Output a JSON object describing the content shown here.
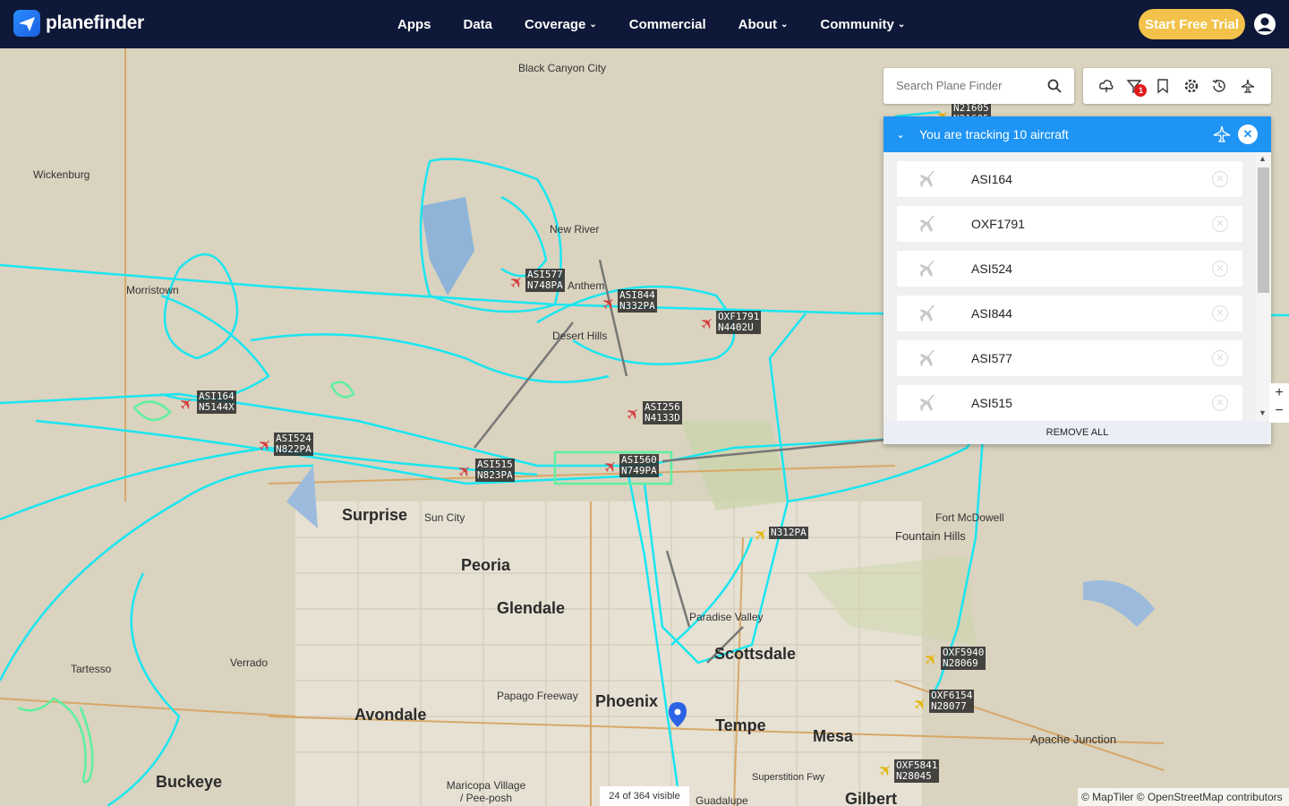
{
  "header": {
    "logo_text": "planefinder",
    "nav": [
      {
        "label": "Apps",
        "dropdown": false
      },
      {
        "label": "Data",
        "dropdown": false
      },
      {
        "label": "Coverage",
        "dropdown": true
      },
      {
        "label": "Commercial",
        "dropdown": false
      },
      {
        "label": "About",
        "dropdown": true
      },
      {
        "label": "Community",
        "dropdown": true
      }
    ],
    "trial_button": "Start Free Trial",
    "brand_color": "#0e1838",
    "accent_color": "#f3c24a"
  },
  "search": {
    "placeholder": "Search Plane Finder",
    "icon": "search-icon"
  },
  "toolbar": {
    "icons": [
      "weather-icon",
      "filter-icon",
      "bookmark-icon",
      "settings-icon",
      "history-icon",
      "aircraft-type-icon"
    ],
    "filter_badge": "1"
  },
  "tracking": {
    "title": "You are tracking 10 aircraft",
    "items": [
      "ASI164",
      "OXF1791",
      "ASI524",
      "ASI844",
      "ASI577",
      "ASI515"
    ],
    "remove_all": "REMOVE ALL",
    "panel_color": "#1e94f4"
  },
  "map": {
    "places": [
      {
        "name": "Black Canyon City",
        "big": false
      },
      {
        "name": "Wickenburg",
        "big": false
      },
      {
        "name": "New River",
        "big": false
      },
      {
        "name": "Anthem",
        "big": false
      },
      {
        "name": "Morristown",
        "big": false
      },
      {
        "name": "Desert Hills",
        "big": false
      },
      {
        "name": "Surprise",
        "big": true
      },
      {
        "name": "Sun City",
        "big": false
      },
      {
        "name": "Peoria",
        "big": true
      },
      {
        "name": "Glendale",
        "big": true
      },
      {
        "name": "Fort McDowell",
        "big": false
      },
      {
        "name": "Fountain Hills",
        "big": false
      },
      {
        "name": "Paradise Valley",
        "big": false
      },
      {
        "name": "Scottsdale",
        "big": true
      },
      {
        "name": "Tartesso",
        "big": false
      },
      {
        "name": "Verrado",
        "big": false
      },
      {
        "name": "Papago Freeway",
        "big": false
      },
      {
        "name": "Phoenix",
        "big": true
      },
      {
        "name": "Avondale",
        "big": true
      },
      {
        "name": "Tempe",
        "big": true
      },
      {
        "name": "Mesa",
        "big": true
      },
      {
        "name": "Apache Junction",
        "big": false
      },
      {
        "name": "Buckeye",
        "big": true
      },
      {
        "name": "Maricopa Village / Pee-posh",
        "big": false
      },
      {
        "name": "Guadalupe",
        "big": false
      },
      {
        "name": "Gilbert",
        "big": true
      },
      {
        "name": "Superstition Fwy",
        "big": false
      }
    ],
    "aircraft": [
      {
        "tag": "ASI577\nN748PA",
        "color": "red"
      },
      {
        "tag": "ASI844\nN332PA",
        "color": "red"
      },
      {
        "tag": "OXF1791\nN4402U",
        "color": "red"
      },
      {
        "tag": "ASI164\nN5144X",
        "color": "red"
      },
      {
        "tag": "ASI524\nN822PA",
        "color": "red"
      },
      {
        "tag": "ASI256\nN4133D",
        "color": "red"
      },
      {
        "tag": "ASI515\nN823PA",
        "color": "red"
      },
      {
        "tag": "ASI560\nN749PA",
        "color": "red"
      },
      {
        "tag": "N312PA",
        "color": "yellow"
      },
      {
        "tag": "OXF5940\nN28069",
        "color": "yellow"
      },
      {
        "tag": "OXF6154\nN28077",
        "color": "yellow"
      },
      {
        "tag": "OXF5841\nN28045",
        "color": "yellow"
      },
      {
        "tag": "N21605\nN21605",
        "color": "yellow"
      }
    ],
    "visible_count": "24 of 364 visible",
    "attribution": "© MapTiler © OpenStreetMap contributors",
    "track_color": "#19e6f0",
    "track_color_alt": "#5ef0a0"
  }
}
